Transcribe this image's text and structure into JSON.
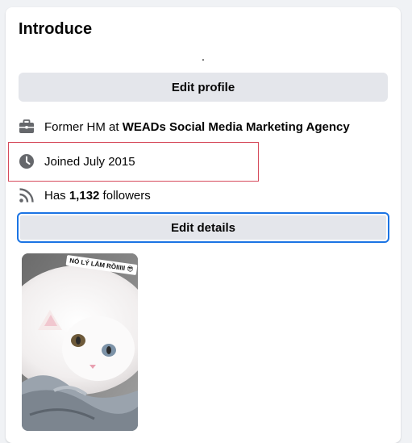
{
  "intro": {
    "title": "Introduce",
    "bio": ".",
    "edit_profile_label": "Edit profile",
    "work_prefix": "Former HM at ",
    "work_company": "WEADs Social Media Marketing Agency",
    "joined_text": "Joined July 2015",
    "followers_prefix": "Has ",
    "followers_count": "1,132",
    "followers_suffix": " followers",
    "edit_details_label": "Edit details"
  },
  "photo": {
    "caption": "NÓ LÝ LẮM RỒIIIII 😎"
  },
  "colors": {
    "page_bg": "#f0f2f5",
    "button_bg": "#e4e6eb",
    "icon": "#65676b",
    "focus_ring": "#1b74e4",
    "highlight_box": "#d64b5c"
  },
  "icons": [
    "briefcase-icon",
    "clock-icon",
    "rss-feed-icon"
  ]
}
